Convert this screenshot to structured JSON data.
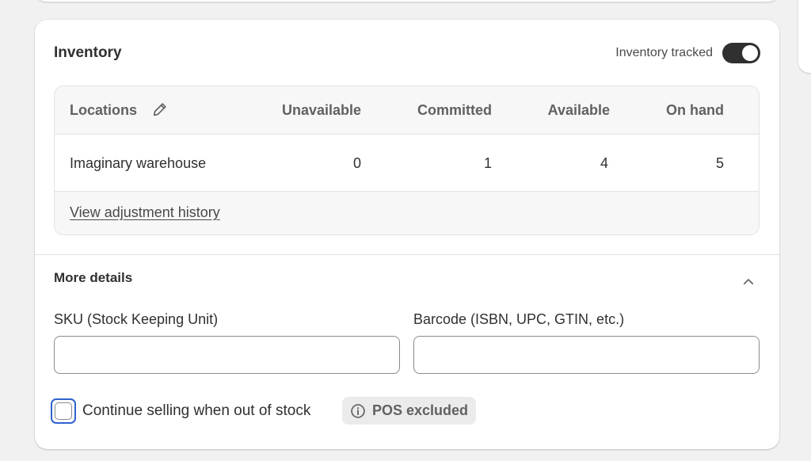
{
  "inventory": {
    "title": "Inventory",
    "tracked_label": "Inventory tracked",
    "tracked_on": true,
    "columns": {
      "locations": "Locations",
      "unavailable": "Unavailable",
      "committed": "Committed",
      "available": "Available",
      "on_hand": "On hand"
    },
    "rows": [
      {
        "location": "Imaginary warehouse",
        "unavailable": "0",
        "committed": "1",
        "available": "4",
        "on_hand": "5"
      }
    ],
    "history_link": "View adjustment history"
  },
  "more_details": {
    "title": "More details",
    "sku_label": "SKU (Stock Keeping Unit)",
    "sku_value": "",
    "barcode_label": "Barcode (ISBN, UPC, GTIN, etc.)",
    "barcode_value": "",
    "continue_selling_label": "Continue selling when out of stock",
    "continue_selling_checked": false,
    "pos_badge": "POS excluded"
  },
  "icons": {
    "edit": "pencil-icon",
    "collapse": "chevron-up-icon",
    "info": "info-icon"
  },
  "colors": {
    "toggle_on": "#303030",
    "focus_ring": "#2f62d0",
    "badge_bg": "#ebebeb"
  }
}
